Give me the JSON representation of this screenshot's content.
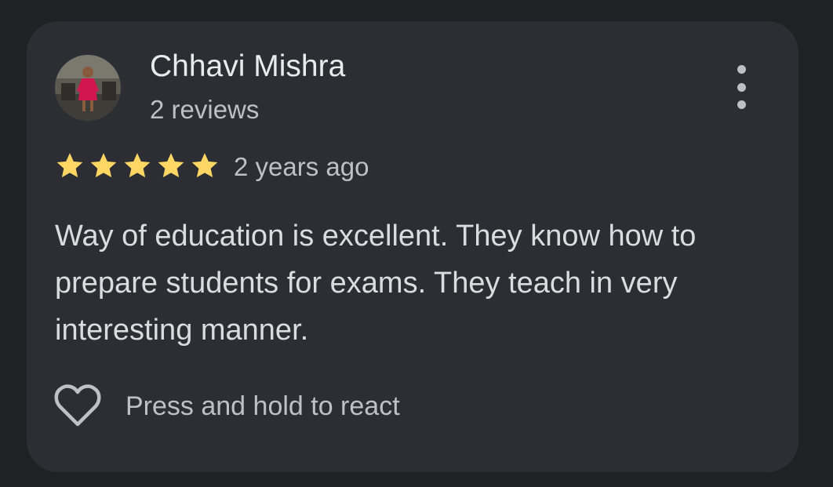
{
  "review": {
    "author_name": "Chhavi Mishra",
    "review_count": "2 reviews",
    "rating": 5,
    "time_ago": "2 years ago",
    "text": "Way of education is excellent. They know how to prepare students for exams. They teach in very interesting manner."
  },
  "actions": {
    "react_label": "Press and hold to react",
    "react_icon": "heart-outline-icon",
    "menu_icon": "more-vert-icon"
  },
  "colors": {
    "background": "#202124",
    "card": "#2d2e33",
    "star": "#fdd663",
    "primary_text": "#e8eaed",
    "secondary_text": "#bdc1c6"
  }
}
